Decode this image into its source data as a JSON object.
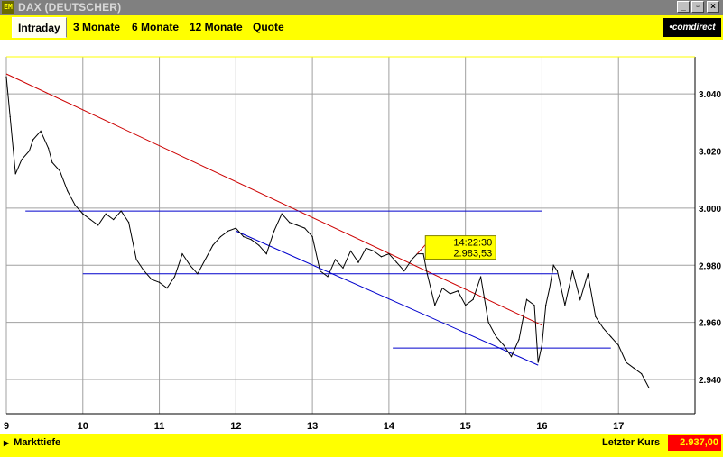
{
  "window": {
    "title": "DAX (DEUTSCHER)",
    "app_icon_text": "EM",
    "minimize_glyph": "_",
    "restore_glyph": "▫",
    "close_glyph": "×"
  },
  "tabs": [
    {
      "label": "Intraday",
      "active": true
    },
    {
      "label": "3 Monate",
      "active": false
    },
    {
      "label": "6 Monate",
      "active": false
    },
    {
      "label": "12 Monate",
      "active": false
    },
    {
      "label": "Quote",
      "active": false
    }
  ],
  "brand": {
    "logo_text": "•comdirect"
  },
  "colors": {
    "accent": "#ffff00",
    "price_line": "#000000",
    "trend_red": "#cc0000",
    "trend_blue": "#0000cc",
    "grid": "#a0a0a0",
    "last_price_bg": "#ff0000"
  },
  "chart_data": {
    "type": "line",
    "x_ticks": [
      "9",
      "10",
      "11",
      "12",
      "13",
      "14",
      "15",
      "16",
      "17"
    ],
    "y_ticks": [
      "3.040",
      "3.020",
      "3.000",
      "2.980",
      "2.960",
      "2.940"
    ],
    "x_range": [
      9,
      18
    ],
    "y_range": [
      2.928,
      3.053
    ],
    "series": [
      {
        "x": [
          9.0,
          9.05,
          9.12,
          9.2,
          9.3,
          9.35,
          9.45,
          9.55,
          9.6,
          9.7,
          9.8,
          9.9,
          10.0,
          10.1,
          10.2,
          10.3,
          10.4,
          10.5,
          10.6,
          10.7,
          10.8,
          10.9,
          11.0,
          11.1,
          11.2,
          11.3,
          11.4,
          11.5,
          11.6,
          11.7,
          11.8,
          11.9,
          12.0,
          12.1,
          12.2,
          12.3,
          12.4,
          12.5,
          12.6,
          12.7,
          12.8,
          12.9,
          13.0,
          13.1,
          13.2,
          13.3,
          13.4,
          13.5,
          13.6,
          13.7,
          13.8,
          13.9,
          14.0,
          14.1,
          14.2,
          14.3,
          14.37,
          14.45,
          14.5,
          14.6,
          14.7,
          14.8,
          14.9,
          15.0,
          15.1,
          15.2,
          15.3,
          15.4,
          15.5,
          15.6,
          15.7,
          15.8,
          15.9,
          15.95,
          16.0,
          16.05,
          16.1,
          16.15,
          16.2,
          16.3,
          16.4,
          16.5,
          16.6,
          16.7,
          16.8,
          16.9,
          17.0,
          17.1,
          17.2,
          17.3,
          17.4
        ],
        "y": [
          3.046,
          3.032,
          3.012,
          3.017,
          3.02,
          3.024,
          3.027,
          3.021,
          3.016,
          3.013,
          3.006,
          3.001,
          2.998,
          2.996,
          2.994,
          2.998,
          2.996,
          2.999,
          2.995,
          2.982,
          2.978,
          2.975,
          2.974,
          2.972,
          2.976,
          2.984,
          2.98,
          2.977,
          2.982,
          2.987,
          2.99,
          2.992,
          2.993,
          2.99,
          2.989,
          2.987,
          2.984,
          2.992,
          2.998,
          2.995,
          2.994,
          2.993,
          2.99,
          2.978,
          2.976,
          2.982,
          2.979,
          2.985,
          2.981,
          2.986,
          2.985,
          2.983,
          2.984,
          2.981,
          2.978,
          2.982,
          2.984,
          2.984,
          2.977,
          2.966,
          2.972,
          2.97,
          2.971,
          2.966,
          2.968,
          2.976,
          2.96,
          2.955,
          2.952,
          2.948,
          2.954,
          2.968,
          2.966,
          2.946,
          2.952,
          2.966,
          2.972,
          2.98,
          2.978,
          2.966,
          2.978,
          2.968,
          2.977,
          2.962,
          2.958,
          2.955,
          2.952,
          2.946,
          2.944,
          2.942,
          2.937
        ]
      }
    ],
    "trendlines": [
      {
        "color": "red",
        "x": [
          9.0,
          16.0
        ],
        "y": [
          3.047,
          2.959
        ]
      },
      {
        "color": "blue",
        "x": [
          12.0,
          15.95
        ],
        "y": [
          2.992,
          2.945
        ]
      },
      {
        "color": "blue",
        "x": [
          9.25,
          16.0
        ],
        "y": [
          2.999,
          2.999
        ]
      },
      {
        "color": "blue",
        "x": [
          10.0,
          16.2
        ],
        "y": [
          2.977,
          2.977
        ]
      },
      {
        "color": "blue",
        "x": [
          14.05,
          16.9
        ],
        "y": [
          2.951,
          2.951
        ]
      }
    ],
    "reference_line": {
      "color": "yellow",
      "y": 3.053
    },
    "annotation": {
      "time": "14:22:30",
      "value": "2.983,53",
      "x": 14.37,
      "y": 2.984
    }
  },
  "footer": {
    "depth_label": "Markttiefe",
    "depth_arrow": "▶",
    "last_price_label": "Letzter Kurs",
    "last_price_value": "2.937,00"
  }
}
